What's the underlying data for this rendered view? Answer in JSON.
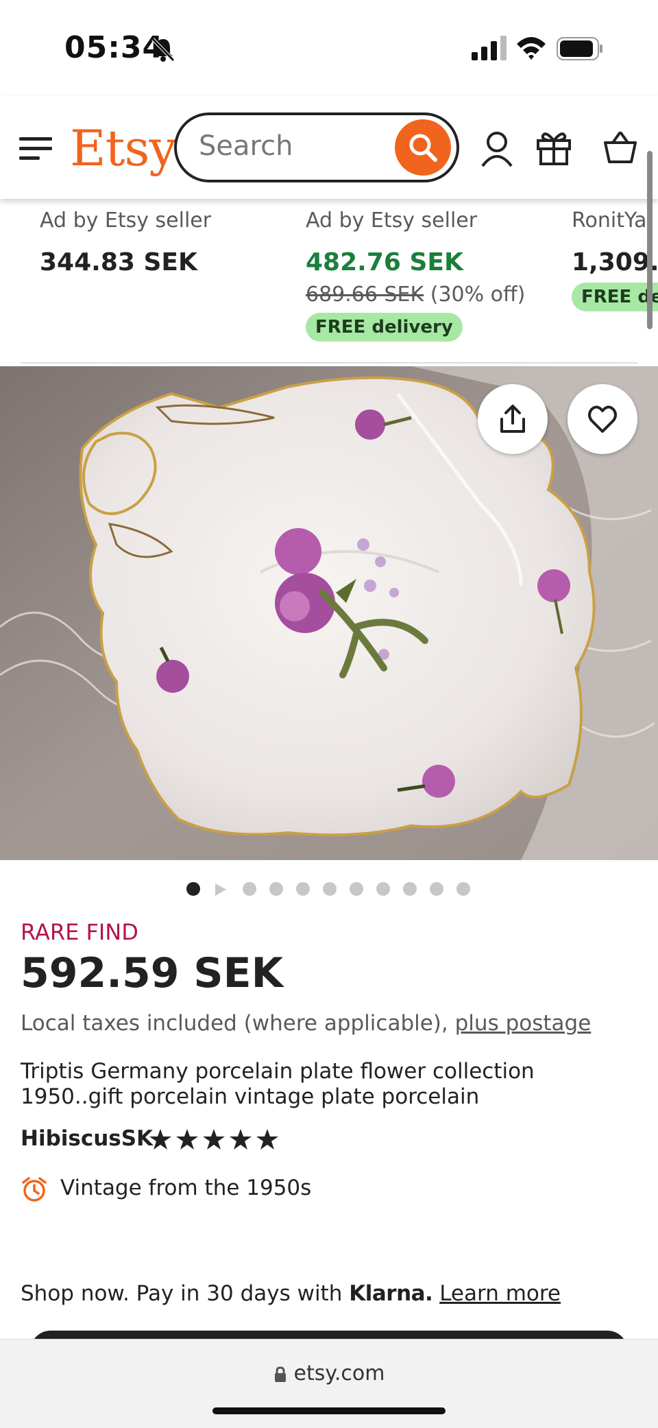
{
  "status": {
    "time": "05:34"
  },
  "header": {
    "logo": "Etsy",
    "search_placeholder": "Search"
  },
  "related": [
    {
      "ad_label": "Ad by Etsy seller",
      "price": "344.83 SEK"
    },
    {
      "ad_label": "Ad by Etsy seller",
      "price": "482.76 SEK",
      "original_price": "689.66 SEK",
      "discount": "(30% off)",
      "badge": "FREE delivery"
    },
    {
      "ad_label": "RonitYa",
      "price": "1,309.",
      "badge": "FREE de"
    }
  ],
  "gallery": {
    "dot_count": 11,
    "active_index": 0
  },
  "listing": {
    "tag": "RARE FIND",
    "price": "592.59 SEK",
    "tax_text": "Local taxes included (where applicable),",
    "postage_link": "plus postage",
    "title": "Triptis Germany porcelain plate flower collection 1950..gift porcelain vintage plate porcelain",
    "shop_name": "HibiscusSK",
    "rating_stars": 5,
    "vintage_note": "Vintage from the 1950s"
  },
  "klarna": {
    "text": "Shop now. Pay in 30 days with",
    "brand": "Klarna.",
    "link": "Learn more"
  },
  "browser": {
    "url": "etsy.com"
  },
  "colors": {
    "brand": "#f1641e",
    "sale_green": "#1a7f3c",
    "rare_red": "#b4134a",
    "badge_green": "#a7e8a4"
  }
}
